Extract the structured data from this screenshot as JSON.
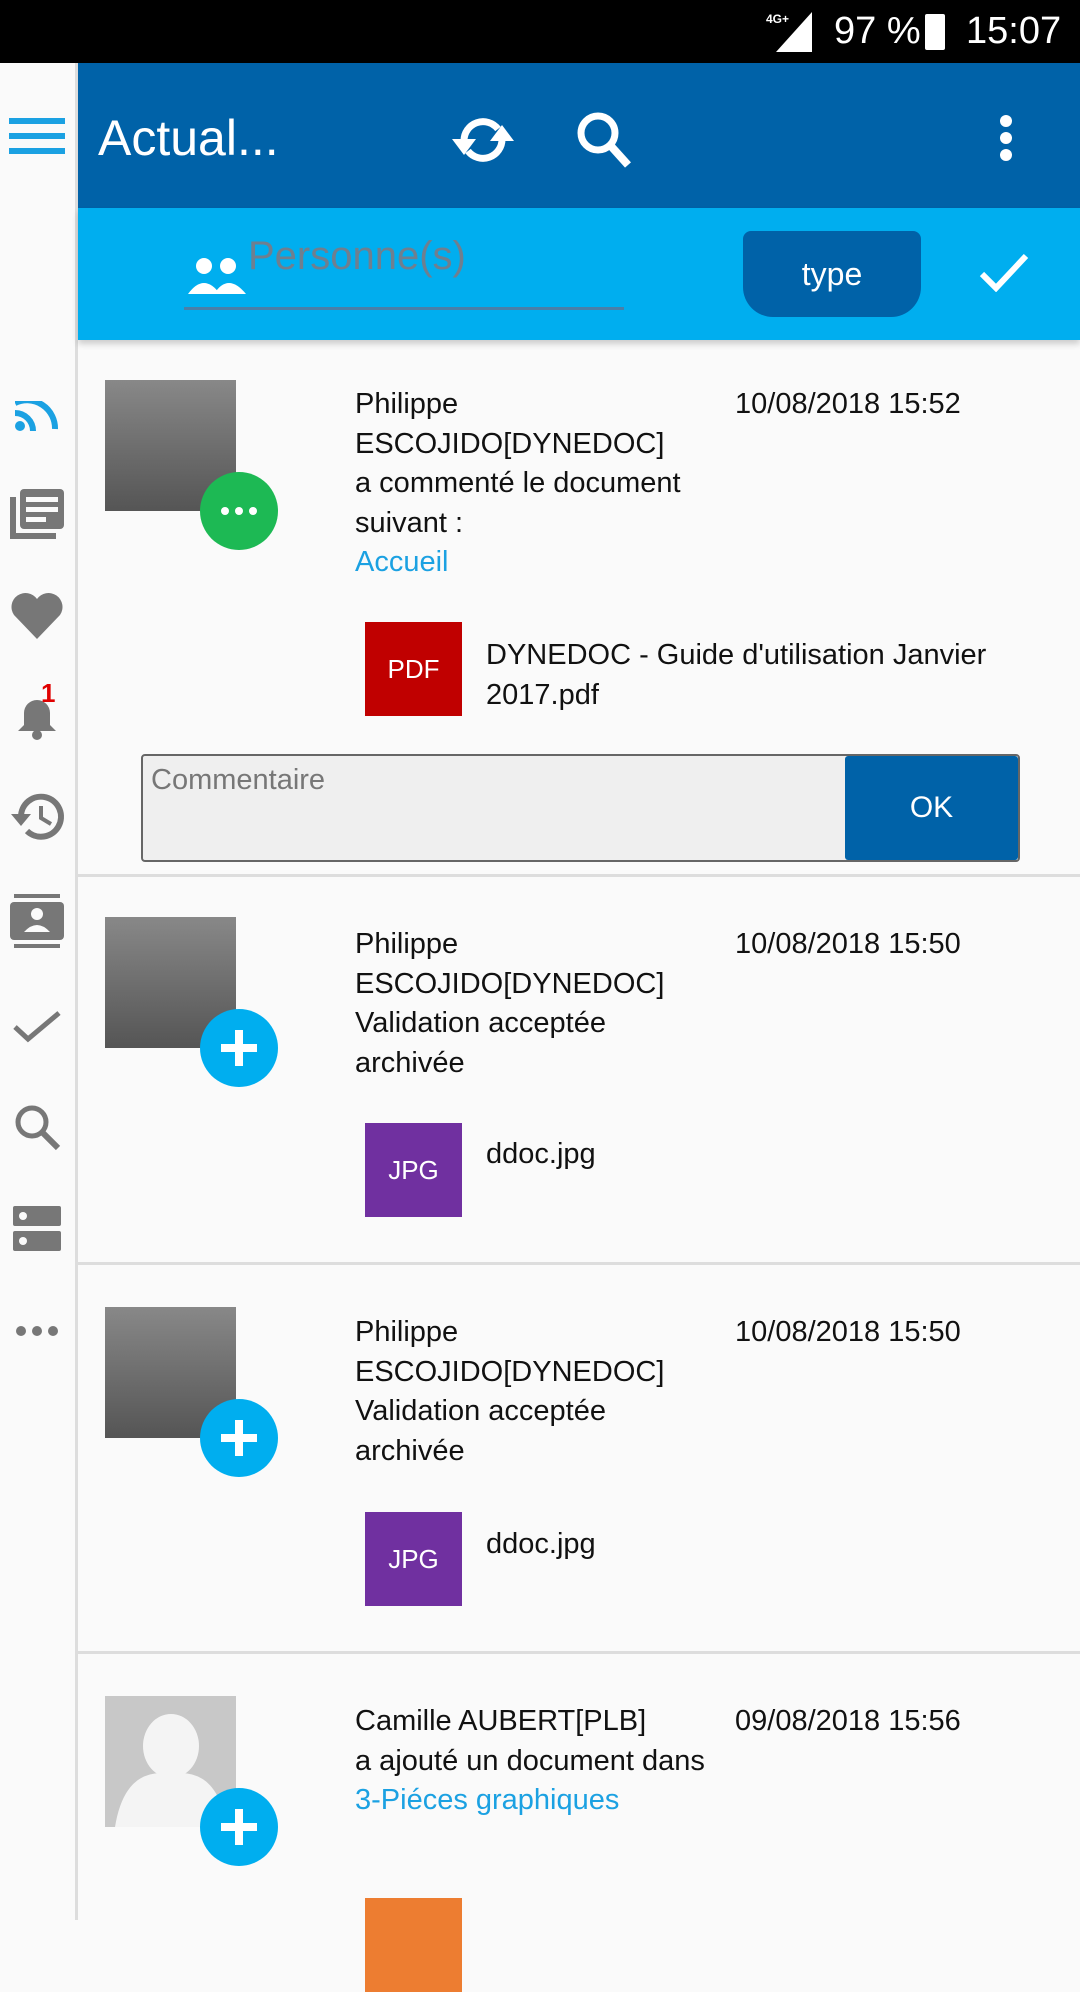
{
  "status_bar": {
    "network": "4G+",
    "battery": "97 %",
    "time": "15:07"
  },
  "toolbar": {
    "title": "Actual...",
    "icons": [
      "menu-icon",
      "sync-icon",
      "search-icon",
      "more-vert-icon"
    ]
  },
  "filter": {
    "persons_placeholder": "Personne(s)",
    "type_label": "type",
    "confirm_icon": "check-icon"
  },
  "sidebar": {
    "items": [
      "rss-icon",
      "news-icon",
      "heart-icon",
      "bell-icon",
      "history-icon",
      "contacts-icon",
      "check-icon",
      "search-icon",
      "storage-icon",
      "more-horiz-icon"
    ],
    "notification_count": "1",
    "active_color": "#1ba1e2"
  },
  "feed": [
    {
      "line1": "Philippe",
      "line2": "ESCOJIDO[DYNEDOC]",
      "action": "a commenté le document suivant :",
      "link": "Accueil",
      "date": "10/08/2018 15:52",
      "badge": "comment",
      "badge_color": "#1db954",
      "file_type": "PDF",
      "file_color": "#c00000",
      "file_name": "DYNEDOC - Guide d'utilisation Janvier 2017.pdf",
      "comment_placeholder": "Commentaire",
      "ok_label": "OK"
    },
    {
      "line1": "Philippe",
      "line2": "ESCOJIDO[DYNEDOC]",
      "action": "Validation acceptée archivée",
      "date": "10/08/2018 15:50",
      "badge": "add",
      "badge_color": "#00aeef",
      "file_type": "JPG",
      "file_color": "#7030a0",
      "file_name": "ddoc.jpg"
    },
    {
      "line1": "Philippe",
      "line2": "ESCOJIDO[DYNEDOC]",
      "action": "Validation acceptée archivée",
      "date": "10/08/2018 15:50",
      "badge": "add",
      "badge_color": "#00aeef",
      "file_type": "JPG",
      "file_color": "#7030a0",
      "file_name": "ddoc.jpg"
    },
    {
      "line1": "Camille AUBERT[PLB]",
      "action": "a ajouté un document dans",
      "link": "3-Piéces graphiques",
      "date": "09/08/2018 15:56",
      "badge": "add",
      "badge_color": "#00aeef",
      "file_color": "#ed7d31"
    }
  ]
}
